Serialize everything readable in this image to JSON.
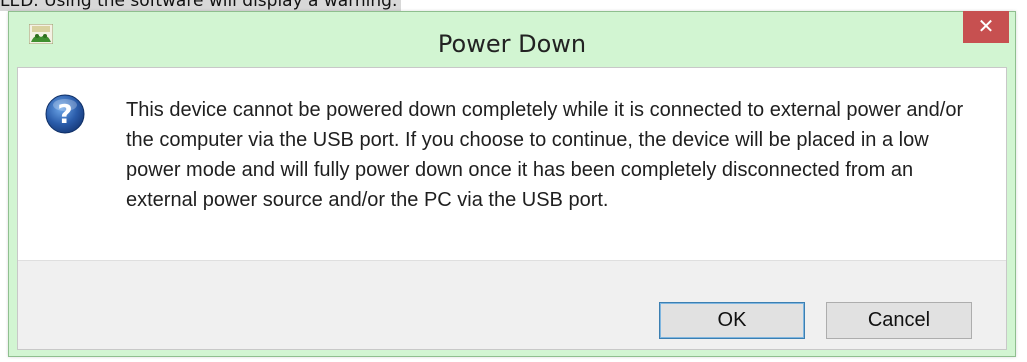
{
  "background_text": "LED. Using the software will display a warning.",
  "dialog": {
    "title": "Power Down",
    "close_glyph": "✕",
    "app_icon": "app-logo-icon",
    "icon": "question-icon",
    "message": "This device cannot be powered down completely while it is connected to external power and/or the computer via the USB port. If you choose to continue, the device will be placed in a low power mode and will fully power down once it has been completely disconnected from an external power source and/or the PC via the USB port.",
    "buttons": {
      "ok_label": "OK",
      "cancel_label": "Cancel"
    },
    "colors": {
      "frame": "#d2f5d2",
      "close": "#c75050",
      "icon_blue": "#2a5caa"
    }
  }
}
